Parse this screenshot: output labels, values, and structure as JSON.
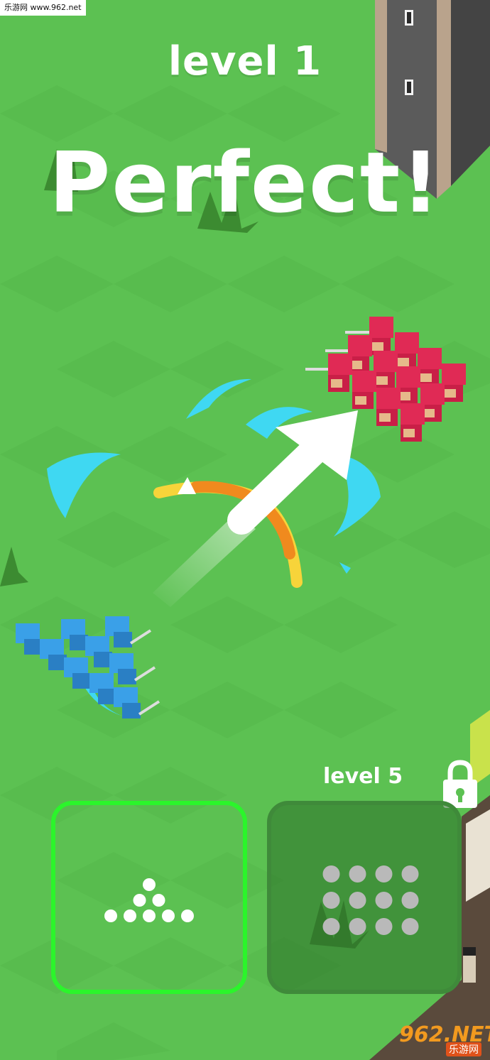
{
  "watermark_top": "乐游网 www.962.net",
  "level_title": "level 1",
  "feedback_text": "Perfect!",
  "formations": [
    {
      "selected": true,
      "locked": false,
      "label": "",
      "dot_rows": [
        1,
        2,
        5
      ],
      "dot_color": "#ffffff"
    },
    {
      "selected": false,
      "locked": true,
      "label": "level 5",
      "dot_rows": [
        4,
        4,
        4
      ],
      "dot_color": "#b9b9b9"
    }
  ],
  "watermark_bottom": {
    "main": "962.NET",
    "sub": "乐游网"
  },
  "colors": {
    "grass": "#5cc152",
    "grass_alt": "#55b74b",
    "selected_border": "#2bf52b",
    "blue_army": "#3aa0e8",
    "red_army": "#e02a55",
    "slash_cyan": "#3fd8f2",
    "arc_yellow": "#f7d43a",
    "arc_orange": "#f08a1e",
    "arrow": "#ffffff",
    "tower": "#5a5a5a"
  },
  "icons": [
    "lock-icon",
    "arrow-icon"
  ]
}
